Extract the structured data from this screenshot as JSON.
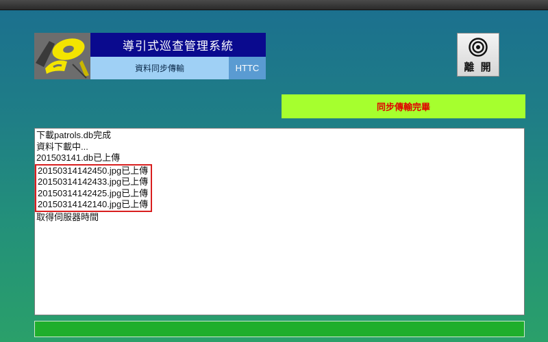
{
  "app": {
    "title": "導引式巡查管理系統",
    "subtitle": "資料同步傳輸",
    "org": "HTTC"
  },
  "exit_button": {
    "label": "離 開",
    "icon": "target-icon"
  },
  "status": {
    "text": "同步傳輸完畢",
    "color": "#e00000",
    "bg": "#a6ff2e"
  },
  "log": {
    "lines_before": [
      "下載patrols.db完成",
      "資料下載中...",
      "201503141.db已上傳"
    ],
    "highlighted": [
      "20150314142450.jpg已上傳",
      "20150314142433.jpg已上傳",
      "20150314142425.jpg已上傳",
      "20150314142140.jpg已上傳"
    ],
    "lines_after": [
      "取得伺服器時間"
    ]
  },
  "progress": {
    "value": 1.0
  }
}
